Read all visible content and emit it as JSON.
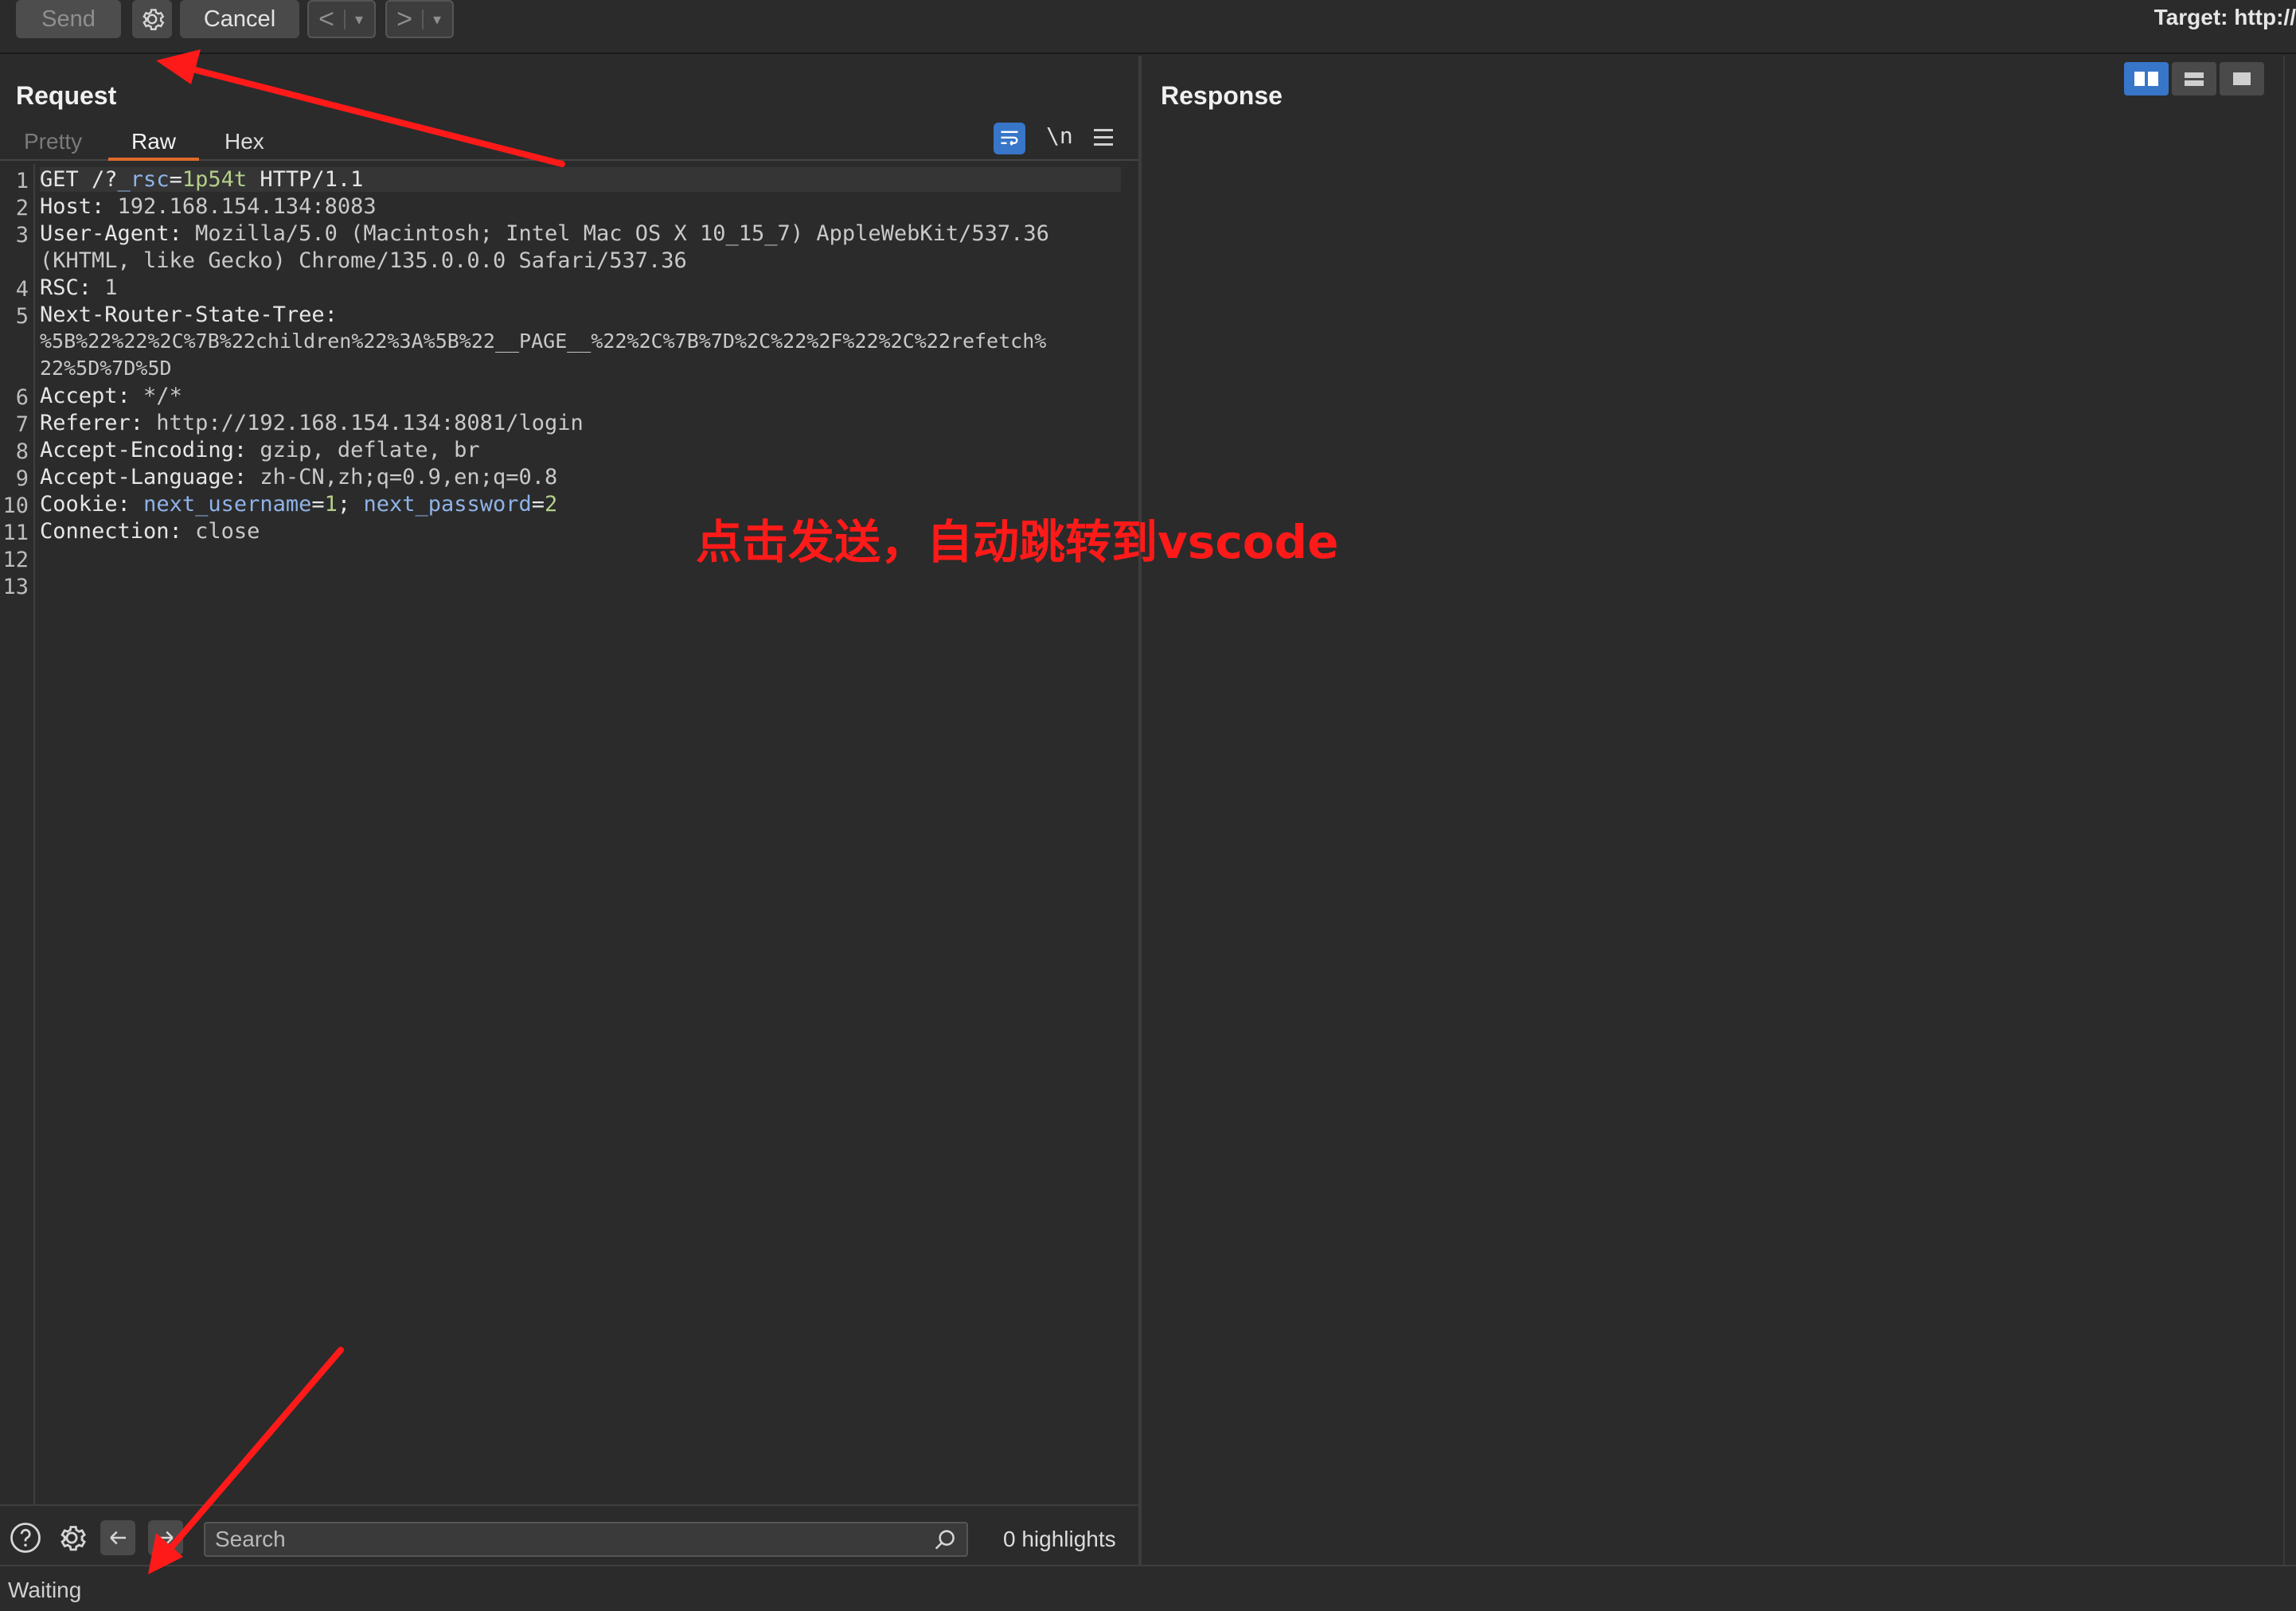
{
  "toolbar": {
    "send_label": "Send",
    "cancel_label": "Cancel",
    "back_arrow": "<",
    "forward_arrow": ">",
    "dropdown_glyph": "▾",
    "target_text": "Target: http://",
    "gear_icon": "gear-icon"
  },
  "request": {
    "title": "Request",
    "tabs": [
      {
        "label": "Pretty"
      },
      {
        "label": "Raw"
      },
      {
        "label": "Hex"
      }
    ],
    "active_tab": "Raw",
    "actions": {
      "newline_label": "\\n",
      "wrap_icon": "wrap-lines-icon",
      "menu_icon": "hamburger-menu-icon"
    },
    "line_numbers": [
      "1",
      "2",
      "3",
      "4",
      "5",
      "6",
      "7",
      "8",
      "9",
      "10",
      "11",
      "12",
      "13"
    ],
    "lines": {
      "l1_method": "GET /?",
      "l1_param_name": "_rsc",
      "l1_eq": "=",
      "l1_param_value": "1p54t",
      "l1_proto": " HTTP/1.1",
      "l2_key": "Host:",
      "l2_val": " 192.168.154.134:8083",
      "l3_key": "User-Agent:",
      "l3_val": " Mozilla/5.0 (Macintosh; Intel Mac OS X 10_15_7) AppleWebKit/537.36",
      "l3_cont": "(KHTML, like Gecko) Chrome/135.0.0.0 Safari/537.36",
      "l4_key": "RSC:",
      "l4_val": " 1",
      "l5_key": "Next-Router-State-Tree:",
      "l5_cont1": "%5B%22%22%2C%7B%22children%22%3A%5B%22__PAGE__%22%2C%7B%7D%2C%22%2F%22%2C%22refetch%",
      "l5_cont2": "22%5D%7D%5D",
      "l6_key": "Accept:",
      "l6_val": " */*",
      "l7_key": "Referer:",
      "l7_val": " http://192.168.154.134:8081/login",
      "l8_key": "Accept-Encoding:",
      "l8_val": " gzip, deflate, br",
      "l9_key": "Accept-Language:",
      "l9_val": " zh-CN,zh;q=0.9,en;q=0.8",
      "l10_key": "Cookie:",
      "l10_c1_name": "next_username",
      "l10_c1_eq": "=",
      "l10_c1_val": "1",
      "l10_sep": "; ",
      "l10_c2_name": "next_password",
      "l10_c2_eq": "=",
      "l10_c2_val": "2",
      "l11_key": "Connection:",
      "l11_val": " close"
    },
    "search": {
      "placeholder": "Search",
      "value": "",
      "highlights": "0 highlights"
    }
  },
  "response": {
    "title": "Response",
    "layout_modes": [
      "split-horizontal",
      "split-vertical",
      "single"
    ],
    "active_layout": "split-horizontal"
  },
  "status": {
    "text": "Waiting"
  },
  "annotation": {
    "text": "点击发送，自动跳转到vscode",
    "color": "#ff1a1a"
  },
  "colors": {
    "accent_blue": "#3776c9",
    "active_tab_underline": "#e06b2a",
    "background": "#2b2b2b"
  }
}
